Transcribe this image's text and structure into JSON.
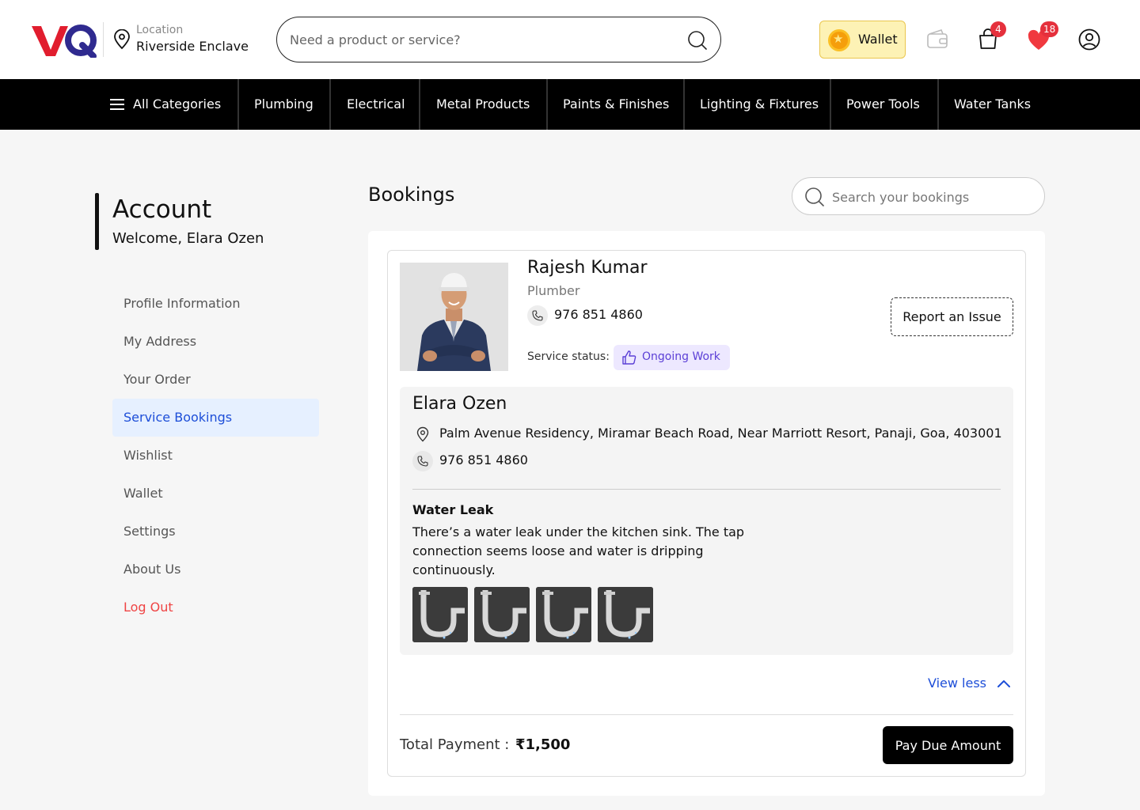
{
  "header": {
    "logo_text": "VQ",
    "location_label": "Location",
    "location_value": "Riverside Enclave",
    "search_placeholder": "Need a product or service?",
    "wallet_label": "Wallet",
    "cart_count": "4",
    "wishlist_count": "18"
  },
  "nav": {
    "all_categories": "All Categories",
    "items": [
      "Plumbing",
      "Electrical",
      "Metal Products",
      "Paints & Finishes",
      "Lighting & Fixtures",
      "Power Tools",
      "Water Tanks"
    ]
  },
  "sidebar": {
    "title": "Account",
    "welcome": "Welcome, Elara Ozen",
    "items": [
      "Profile Information",
      "My Address",
      "Your Order",
      "Service Bookings",
      "Wishlist",
      "Wallet",
      "Settings",
      "About Us",
      "Log Out"
    ],
    "active": "Service Bookings"
  },
  "main": {
    "title": "Bookings",
    "search_placeholder": "Search your bookings"
  },
  "booking": {
    "professional": {
      "name": "Rajesh Kumar",
      "role": "Plumber",
      "phone": "976 851 4860"
    },
    "status_label": "Service status:",
    "status_value": "Ongoing Work",
    "report_label": "Report an Issue",
    "customer": {
      "name": "Elara Ozen",
      "address": "Palm Avenue Residency, Miramar Beach Road, Near Marriott Resort, Panaji, Goa, 403001",
      "phone": "976 851 4860"
    },
    "issue_title": "Water Leak",
    "issue_description": "There’s a water leak under the kitchen sink. The tap connection seems loose and water is dripping continuously.",
    "view_less": "View less",
    "total_label": "Total Payment :",
    "total_value": "₹1,500",
    "pay_label": "Pay Due Amount"
  },
  "colors": {
    "accent_blue": "#1d4ed8",
    "logout_red": "#ef4444",
    "status_purple": "#5b3fd6",
    "badge_red": "#e5303c",
    "wallet_yellow": "#fdf2b5"
  }
}
